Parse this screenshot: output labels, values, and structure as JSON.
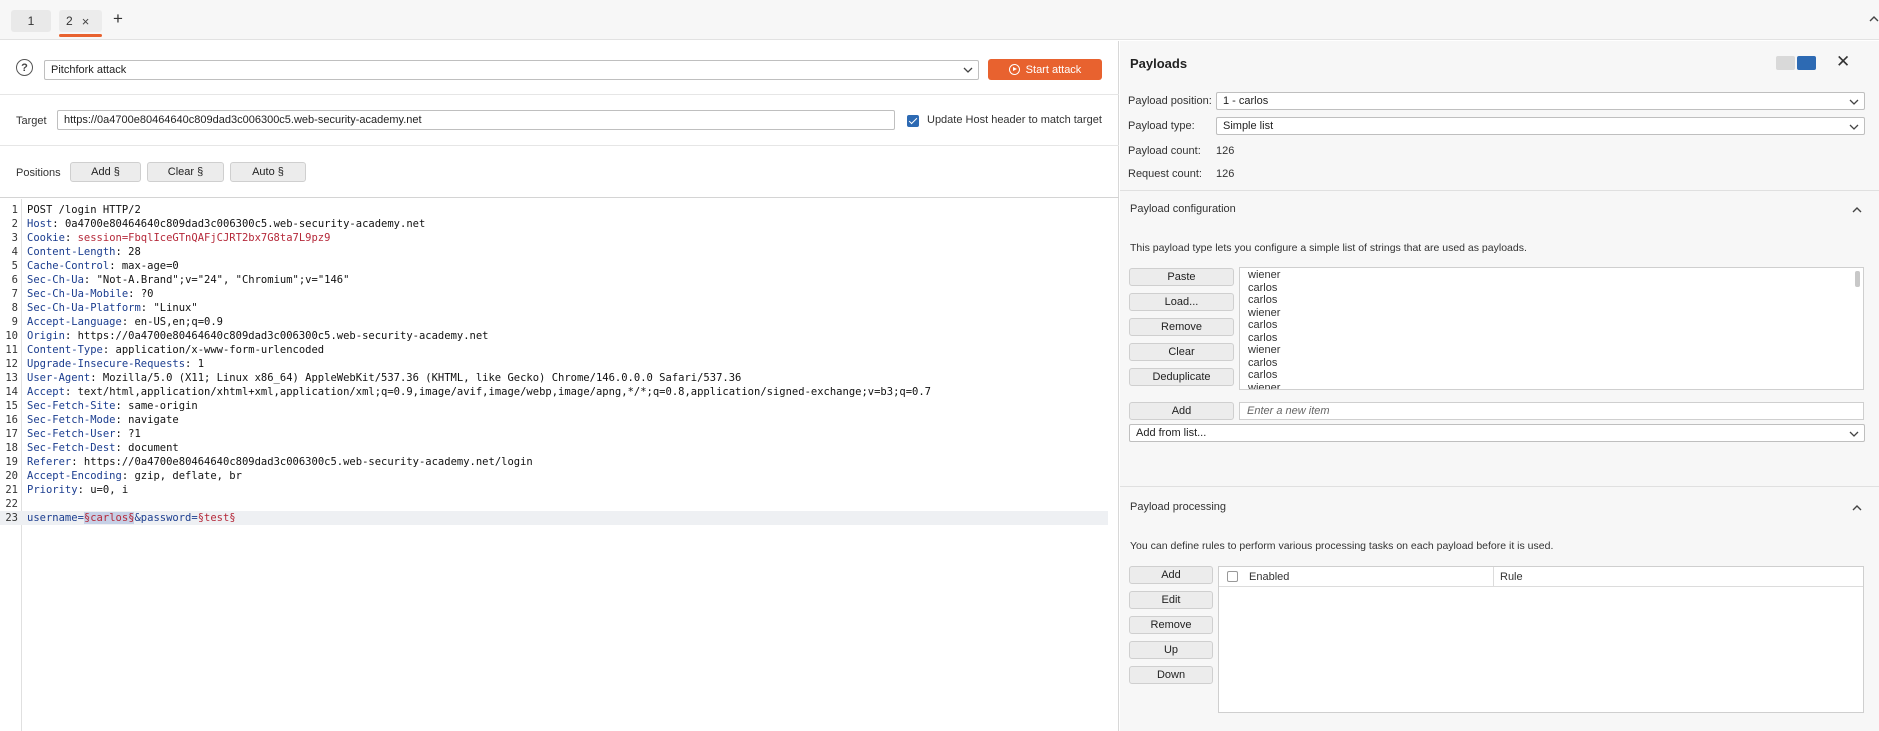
{
  "tabs": [
    {
      "label": "1"
    },
    {
      "label": "2",
      "active": true
    }
  ],
  "attack": {
    "type": "Pitchfork attack",
    "start_label": "Start attack"
  },
  "target": {
    "label": "Target",
    "url": "https://0a4700e80464640c809dad3c006300c5.web-security-academy.net",
    "update_host_label": "Update Host header to match target",
    "update_host_checked": true
  },
  "positions": {
    "label": "Positions",
    "add_label": "Add §",
    "clear_label": "Clear §",
    "auto_label": "Auto §"
  },
  "request": {
    "line1": "POST /login HTTP/2",
    "headers": [
      {
        "n": "2",
        "name": "Host",
        "value": "0a4700e80464640c809dad3c006300c5.web-security-academy.net"
      },
      {
        "n": "3",
        "name": "Cookie",
        "value": "session=FbqlIceGTnQAFjCJRT2bx7G8ta7L9pz9"
      },
      {
        "n": "4",
        "name": "Content-Length",
        "value": "28"
      },
      {
        "n": "5",
        "name": "Cache-Control",
        "value": "max-age=0"
      },
      {
        "n": "6",
        "name": "Sec-Ch-Ua",
        "value": "\"Not-A.Brand\";v=\"24\", \"Chromium\";v=\"146\""
      },
      {
        "n": "7",
        "name": "Sec-Ch-Ua-Mobile",
        "value": "?0"
      },
      {
        "n": "8",
        "name": "Sec-Ch-Ua-Platform",
        "value": "\"Linux\""
      },
      {
        "n": "9",
        "name": "Accept-Language",
        "value": "en-US,en;q=0.9"
      },
      {
        "n": "10",
        "name": "Origin",
        "value": "https://0a4700e80464640c809dad3c006300c5.web-security-academy.net"
      },
      {
        "n": "11",
        "name": "Content-Type",
        "value": "application/x-www-form-urlencoded"
      },
      {
        "n": "12",
        "name": "Upgrade-Insecure-Requests",
        "value": "1"
      },
      {
        "n": "13",
        "name": "User-Agent",
        "value": "Mozilla/5.0 (X11; Linux x86_64) AppleWebKit/537.36 (KHTML, like Gecko) Chrome/146.0.0.0 Safari/537.36"
      },
      {
        "n": "14",
        "name": "Accept",
        "value": "text/html,application/xhtml+xml,application/xml;q=0.9,image/avif,image/webp,image/apng,*/*;q=0.8,application/signed-exchange;v=b3;q=0.7"
      },
      {
        "n": "15",
        "name": "Sec-Fetch-Site",
        "value": "same-origin"
      },
      {
        "n": "16",
        "name": "Sec-Fetch-Mode",
        "value": "navigate"
      },
      {
        "n": "17",
        "name": "Sec-Fetch-User",
        "value": "?1"
      },
      {
        "n": "18",
        "name": "Sec-Fetch-Dest",
        "value": "document"
      },
      {
        "n": "19",
        "name": "Referer",
        "value": "https://0a4700e80464640c809dad3c006300c5.web-security-academy.net/login"
      },
      {
        "n": "20",
        "name": "Accept-Encoding",
        "value": "gzip, deflate, br"
      },
      {
        "n": "21",
        "name": "Priority",
        "value": "u=0, i"
      }
    ],
    "body": {
      "p1": "username=",
      "pos1": "§carlos§",
      "p2": "&password=",
      "pos2": "§test§"
    }
  },
  "payloads": {
    "title": "Payloads",
    "position_label": "Payload position:",
    "position_value": "1 - carlos",
    "type_label": "Payload type:",
    "type_value": "Simple list",
    "count_label": "Payload count:",
    "count_value": "126",
    "request_label": "Request count:",
    "request_value": "126"
  },
  "config": {
    "title": "Payload configuration",
    "description": "This payload type lets you configure a simple list of strings that are used as payloads.",
    "buttons": [
      "Paste",
      "Load...",
      "Remove",
      "Clear",
      "Deduplicate"
    ],
    "items": [
      "wiener",
      "carlos",
      "carlos",
      "wiener",
      "carlos",
      "carlos",
      "wiener",
      "carlos",
      "carlos",
      "wiener"
    ],
    "add_label": "Add",
    "new_item_placeholder": "Enter a new item",
    "add_from_list": "Add from list..."
  },
  "processing": {
    "title": "Payload processing",
    "description": "You can define rules to perform various processing tasks on each payload before it is used.",
    "buttons": [
      "Add",
      "Edit",
      "Remove",
      "Up",
      "Down"
    ],
    "col_enabled": "Enabled",
    "col_rule": "Rule"
  }
}
